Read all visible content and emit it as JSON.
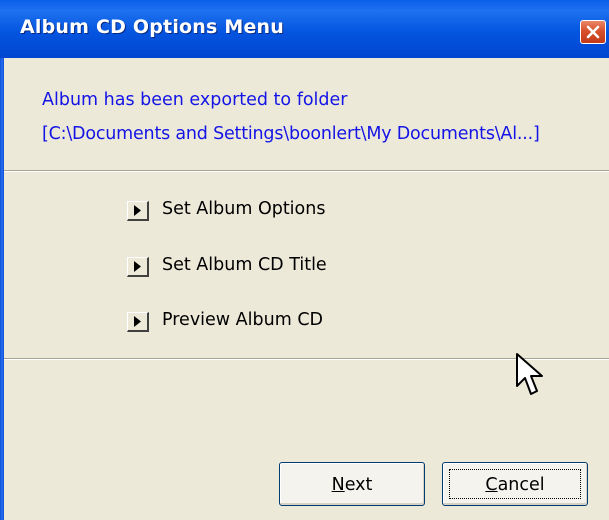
{
  "window": {
    "title": "Album CD Options Menu"
  },
  "message": {
    "line1": "Album has been exported to folder",
    "line2": "[C:\\Documents and Settings\\boonlert\\My Documents\\Al...]"
  },
  "menu": {
    "items": [
      {
        "label": "Set Album Options",
        "icon": "play-arrow-icon"
      },
      {
        "label": "Set Album CD Title",
        "icon": "play-arrow-icon"
      },
      {
        "label": "Preview Album CD",
        "icon": "play-arrow-icon"
      }
    ]
  },
  "buttons": {
    "next_mnemonic": "N",
    "next_rest": "ext",
    "cancel_mnemonic": "C",
    "cancel_rest": "ancel"
  },
  "icons": {
    "close": "close-icon",
    "cursor": "mouse-pointer-icon"
  },
  "colors": {
    "titlebar": "#0555e0",
    "dialog_background": "#ece9d8",
    "message_text": "#1414e6",
    "close_button": "#d9502c"
  }
}
